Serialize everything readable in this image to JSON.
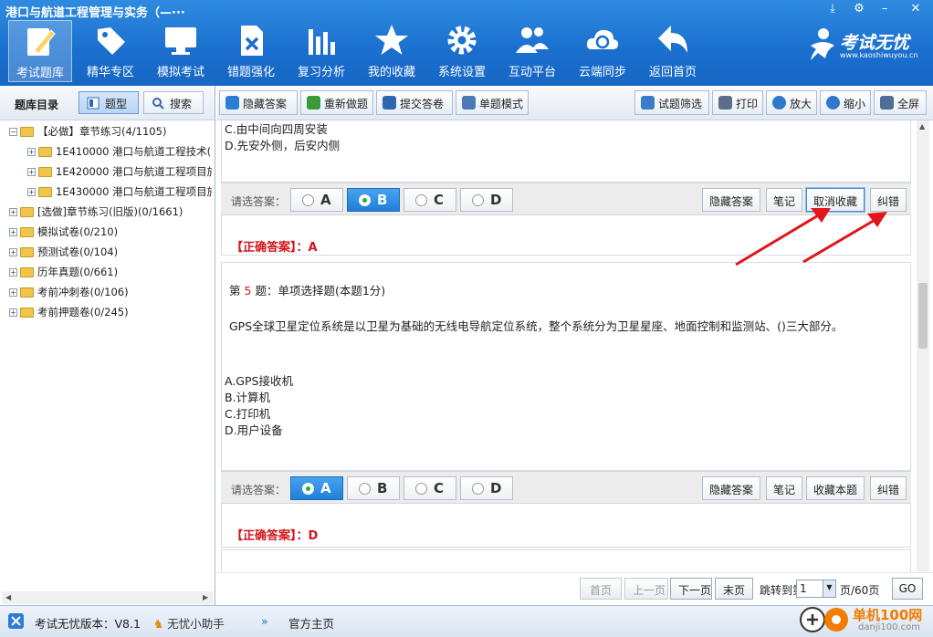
{
  "window": {
    "title": "港口与航道工程管理与实务（—···",
    "controls": [
      "⤓",
      "⚙",
      "–",
      "✕"
    ]
  },
  "toolbar": {
    "items": [
      {
        "label": "考试题库",
        "icon": "pencil-book-icon",
        "active": true
      },
      {
        "label": "精华专区",
        "icon": "tag-icon"
      },
      {
        "label": "模拟考试",
        "icon": "monitor-icon"
      },
      {
        "label": "错题强化",
        "icon": "wrong-file-icon"
      },
      {
        "label": "复习分析",
        "icon": "bar-chart-icon"
      },
      {
        "label": "我的收藏",
        "icon": "star-icon"
      },
      {
        "label": "系统设置",
        "icon": "gear-icon"
      },
      {
        "label": "互动平台",
        "icon": "users-icon"
      },
      {
        "label": "云端同步",
        "icon": "cloud-sync-icon"
      },
      {
        "label": "返回首页",
        "icon": "back-arrow-icon"
      }
    ]
  },
  "brand": {
    "name": "考试无忧",
    "url": "www.kaoshiwuyou.cn"
  },
  "left": {
    "title": "题库目录",
    "btn_type": "题型",
    "btn_search": "搜索",
    "tree": [
      {
        "label": "【必做】章节练习(4/1105)",
        "level": 0,
        "expanded": true
      },
      {
        "label": "1E410000 港口与航道工程技术(",
        "level": 1
      },
      {
        "label": "1E420000 港口与航道工程项目施",
        "level": 1
      },
      {
        "label": "1E430000 港口与航道工程项目施",
        "level": 1
      },
      {
        "label": "[选做]章节练习(旧版)(0/1661)",
        "level": 0
      },
      {
        "label": "模拟试卷(0/210)",
        "level": 0
      },
      {
        "label": "预测试卷(0/104)",
        "level": 0
      },
      {
        "label": "历年真题(0/661)",
        "level": 0
      },
      {
        "label": "考前冲刺卷(0/106)",
        "level": 0
      },
      {
        "label": "考前押题卷(0/245)",
        "level": 0
      }
    ]
  },
  "main_toolbar": {
    "hide_answer": "隐藏答案",
    "redo": "重新做题",
    "submit": "提交答卷",
    "single_mode": "单题模式",
    "filter": "试题筛选",
    "print": "打印",
    "zoom_in": "放大",
    "zoom_out": "缩小",
    "fullscreen": "全屏"
  },
  "question_prev": {
    "option_c": "C.由中间向四周安装",
    "option_d": "D.先安外侧，后安内侧",
    "prompt": "请选答案：",
    "choices": [
      "A",
      "B",
      "C",
      "D"
    ],
    "selected": "B",
    "btn_hide": "隐藏答案",
    "btn_note": "笔记",
    "btn_fav": "取消收藏",
    "btn_fix": "纠错",
    "correct_label": "【正确答案】：",
    "correct_value": "A"
  },
  "question_5": {
    "title_prefix": "第",
    "number": "5",
    "title_suffix": "题：单项选择题(本题1分)",
    "stem": "GPS全球卫星定位系统是以卫星为基础的无线电导航定位系统，整个系统分为卫星星座、地面控制和监测站、()三大部分。",
    "options": [
      "A.GPS接收机",
      "B.计算机",
      "C.打印机",
      "D.用户设备"
    ],
    "prompt": "请选答案：",
    "choices": [
      "A",
      "B",
      "C",
      "D"
    ],
    "selected": "A",
    "btn_hide": "隐藏答案",
    "btn_note": "笔记",
    "btn_fav": "收藏本题",
    "btn_fix": "纠错",
    "correct_label": "【正确答案】：",
    "correct_value": "D"
  },
  "pager": {
    "first": "首页",
    "prev": "上一页",
    "next": "下一页",
    "last": "末页",
    "jump_label": "跳转到第",
    "page_value": "1",
    "page_total": "页/60页",
    "go": "GO"
  },
  "status": {
    "version": "考试无忧版本：V8.1",
    "helper": "无忧小助手",
    "home": "官方主页"
  },
  "watermark": {
    "text": "单机100网",
    "url": "danji100.com"
  },
  "colors": {
    "brand_blue": "#1a6fce",
    "correct_red": "#d2161b",
    "selected_blue": "#1f7fd8",
    "annotation_red": "#e0161b"
  }
}
